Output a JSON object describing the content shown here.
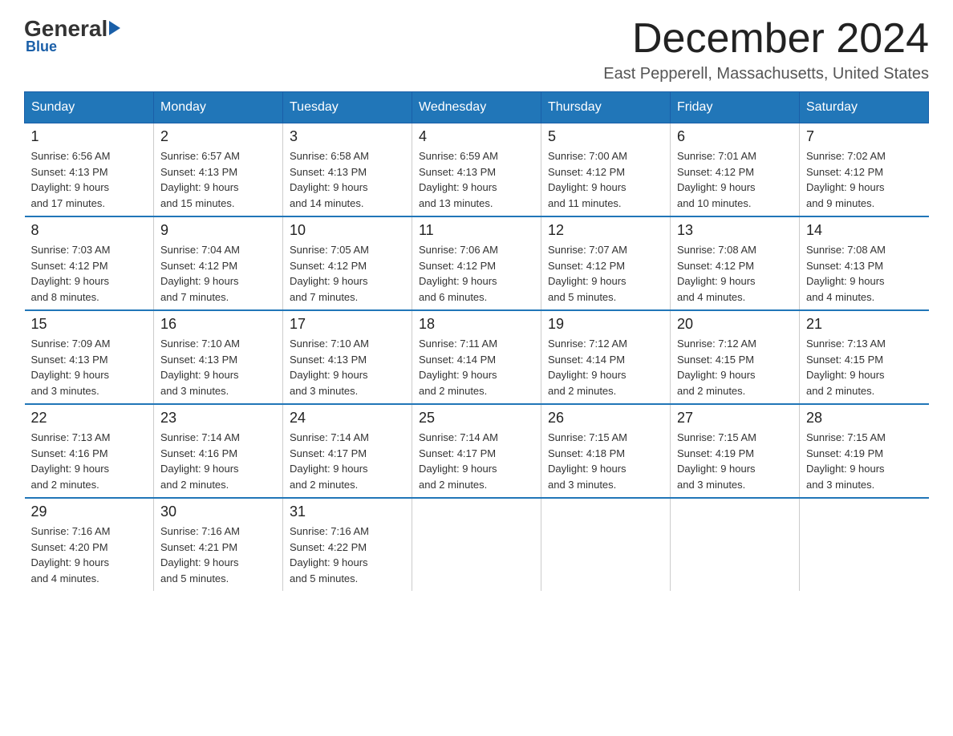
{
  "logo": {
    "general": "General",
    "blue": "Blue",
    "underline": "Blue"
  },
  "header": {
    "month_title": "December 2024",
    "location": "East Pepperell, Massachusetts, United States"
  },
  "weekdays": [
    "Sunday",
    "Monday",
    "Tuesday",
    "Wednesday",
    "Thursday",
    "Friday",
    "Saturday"
  ],
  "weeks": [
    [
      {
        "day": "1",
        "info": "Sunrise: 6:56 AM\nSunset: 4:13 PM\nDaylight: 9 hours\nand 17 minutes."
      },
      {
        "day": "2",
        "info": "Sunrise: 6:57 AM\nSunset: 4:13 PM\nDaylight: 9 hours\nand 15 minutes."
      },
      {
        "day": "3",
        "info": "Sunrise: 6:58 AM\nSunset: 4:13 PM\nDaylight: 9 hours\nand 14 minutes."
      },
      {
        "day": "4",
        "info": "Sunrise: 6:59 AM\nSunset: 4:13 PM\nDaylight: 9 hours\nand 13 minutes."
      },
      {
        "day": "5",
        "info": "Sunrise: 7:00 AM\nSunset: 4:12 PM\nDaylight: 9 hours\nand 11 minutes."
      },
      {
        "day": "6",
        "info": "Sunrise: 7:01 AM\nSunset: 4:12 PM\nDaylight: 9 hours\nand 10 minutes."
      },
      {
        "day": "7",
        "info": "Sunrise: 7:02 AM\nSunset: 4:12 PM\nDaylight: 9 hours\nand 9 minutes."
      }
    ],
    [
      {
        "day": "8",
        "info": "Sunrise: 7:03 AM\nSunset: 4:12 PM\nDaylight: 9 hours\nand 8 minutes."
      },
      {
        "day": "9",
        "info": "Sunrise: 7:04 AM\nSunset: 4:12 PM\nDaylight: 9 hours\nand 7 minutes."
      },
      {
        "day": "10",
        "info": "Sunrise: 7:05 AM\nSunset: 4:12 PM\nDaylight: 9 hours\nand 7 minutes."
      },
      {
        "day": "11",
        "info": "Sunrise: 7:06 AM\nSunset: 4:12 PM\nDaylight: 9 hours\nand 6 minutes."
      },
      {
        "day": "12",
        "info": "Sunrise: 7:07 AM\nSunset: 4:12 PM\nDaylight: 9 hours\nand 5 minutes."
      },
      {
        "day": "13",
        "info": "Sunrise: 7:08 AM\nSunset: 4:12 PM\nDaylight: 9 hours\nand 4 minutes."
      },
      {
        "day": "14",
        "info": "Sunrise: 7:08 AM\nSunset: 4:13 PM\nDaylight: 9 hours\nand 4 minutes."
      }
    ],
    [
      {
        "day": "15",
        "info": "Sunrise: 7:09 AM\nSunset: 4:13 PM\nDaylight: 9 hours\nand 3 minutes."
      },
      {
        "day": "16",
        "info": "Sunrise: 7:10 AM\nSunset: 4:13 PM\nDaylight: 9 hours\nand 3 minutes."
      },
      {
        "day": "17",
        "info": "Sunrise: 7:10 AM\nSunset: 4:13 PM\nDaylight: 9 hours\nand 3 minutes."
      },
      {
        "day": "18",
        "info": "Sunrise: 7:11 AM\nSunset: 4:14 PM\nDaylight: 9 hours\nand 2 minutes."
      },
      {
        "day": "19",
        "info": "Sunrise: 7:12 AM\nSunset: 4:14 PM\nDaylight: 9 hours\nand 2 minutes."
      },
      {
        "day": "20",
        "info": "Sunrise: 7:12 AM\nSunset: 4:15 PM\nDaylight: 9 hours\nand 2 minutes."
      },
      {
        "day": "21",
        "info": "Sunrise: 7:13 AM\nSunset: 4:15 PM\nDaylight: 9 hours\nand 2 minutes."
      }
    ],
    [
      {
        "day": "22",
        "info": "Sunrise: 7:13 AM\nSunset: 4:16 PM\nDaylight: 9 hours\nand 2 minutes."
      },
      {
        "day": "23",
        "info": "Sunrise: 7:14 AM\nSunset: 4:16 PM\nDaylight: 9 hours\nand 2 minutes."
      },
      {
        "day": "24",
        "info": "Sunrise: 7:14 AM\nSunset: 4:17 PM\nDaylight: 9 hours\nand 2 minutes."
      },
      {
        "day": "25",
        "info": "Sunrise: 7:14 AM\nSunset: 4:17 PM\nDaylight: 9 hours\nand 2 minutes."
      },
      {
        "day": "26",
        "info": "Sunrise: 7:15 AM\nSunset: 4:18 PM\nDaylight: 9 hours\nand 3 minutes."
      },
      {
        "day": "27",
        "info": "Sunrise: 7:15 AM\nSunset: 4:19 PM\nDaylight: 9 hours\nand 3 minutes."
      },
      {
        "day": "28",
        "info": "Sunrise: 7:15 AM\nSunset: 4:19 PM\nDaylight: 9 hours\nand 3 minutes."
      }
    ],
    [
      {
        "day": "29",
        "info": "Sunrise: 7:16 AM\nSunset: 4:20 PM\nDaylight: 9 hours\nand 4 minutes."
      },
      {
        "day": "30",
        "info": "Sunrise: 7:16 AM\nSunset: 4:21 PM\nDaylight: 9 hours\nand 5 minutes."
      },
      {
        "day": "31",
        "info": "Sunrise: 7:16 AM\nSunset: 4:22 PM\nDaylight: 9 hours\nand 5 minutes."
      },
      null,
      null,
      null,
      null
    ]
  ]
}
